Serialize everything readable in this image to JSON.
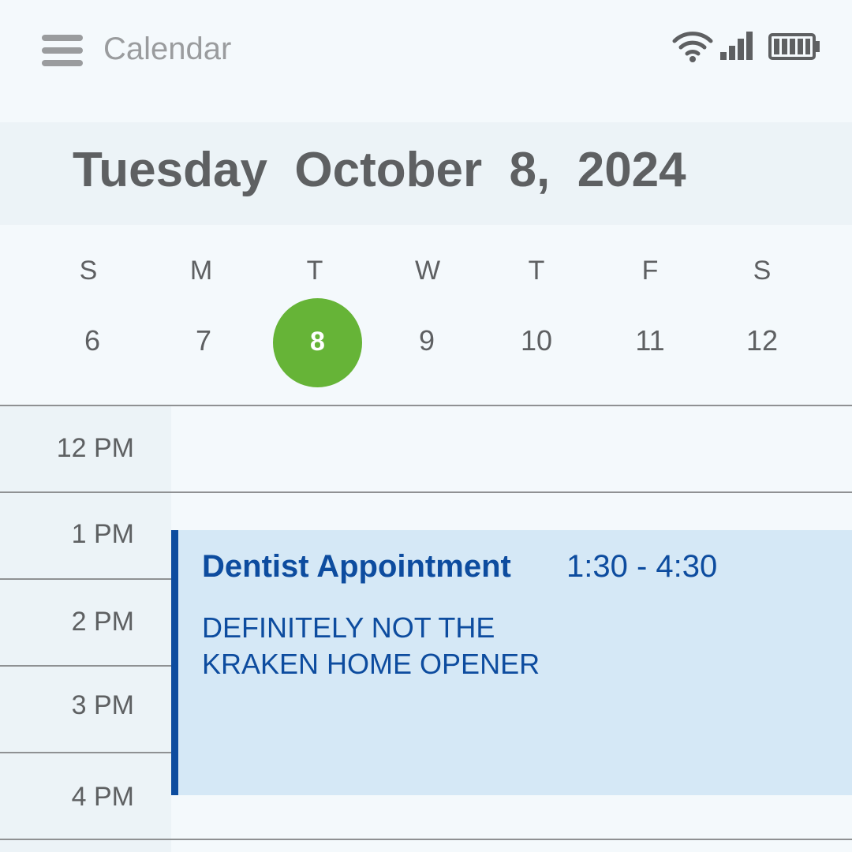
{
  "header": {
    "app_title": "Calendar",
    "menu_icon": "hamburger-menu-icon",
    "status_icons": [
      "wifi-icon",
      "cellular-signal-icon",
      "battery-full-icon"
    ]
  },
  "date_title": "Tuesday  October  8,  2024",
  "week": {
    "days": [
      {
        "letter": "S",
        "number": "6"
      },
      {
        "letter": "M",
        "number": "7"
      },
      {
        "letter": "T",
        "number": "8",
        "selected": true
      },
      {
        "letter": "W",
        "number": "9"
      },
      {
        "letter": "T",
        "number": "10"
      },
      {
        "letter": "F",
        "number": "11"
      },
      {
        "letter": "S",
        "number": "12"
      }
    ],
    "selected_color": "#66b437"
  },
  "timeline": {
    "hours": [
      "12 PM",
      "1 PM",
      "2 PM",
      "3 PM",
      "4 PM"
    ]
  },
  "event": {
    "title": "Dentist Appointment",
    "time": "1:30 - 4:30",
    "description_lines": [
      "DEFINITELY NOT THE",
      "KRAKEN HOME OPENER"
    ],
    "accent_color": "#0d4c9f",
    "background_color": "#d5e8f6"
  }
}
